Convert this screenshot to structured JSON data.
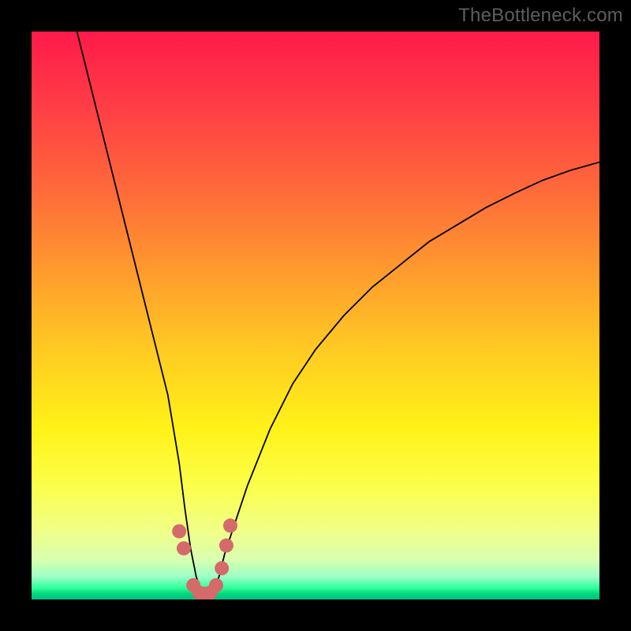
{
  "watermark": "TheBottleneck.com",
  "chart_data": {
    "type": "line",
    "title": "",
    "xlabel": "",
    "ylabel": "",
    "xlim": [
      0,
      100
    ],
    "ylim": [
      0,
      100
    ],
    "grid": false,
    "series": [
      {
        "name": "bottleneck-curve",
        "x": [
          8,
          10,
          12,
          14,
          16,
          18,
          20,
          22,
          24,
          26,
          27,
          28,
          29,
          30,
          31,
          32,
          33,
          34,
          36,
          38,
          42,
          46,
          50,
          55,
          60,
          65,
          70,
          75,
          80,
          85,
          90,
          95,
          100
        ],
        "y": [
          100,
          92,
          84,
          76,
          68,
          60,
          52,
          44,
          36,
          24,
          16,
          9,
          4,
          1,
          0,
          1,
          4,
          8,
          14,
          20,
          30,
          38,
          44,
          50,
          55,
          59,
          63,
          66,
          69,
          71.5,
          73.8,
          75.6,
          77
        ]
      }
    ],
    "markers": {
      "name": "highlight-dots",
      "color": "#d56a6a",
      "x": [
        26.0,
        26.8,
        28.5,
        29.5,
        30.5,
        31.5,
        32.5,
        33.5,
        34.3,
        35.0
      ],
      "y": [
        12.0,
        9.0,
        2.5,
        1.2,
        1.0,
        1.2,
        2.5,
        5.5,
        9.5,
        13.0
      ]
    },
    "background": {
      "type": "vertical-gradient",
      "stops": [
        {
          "pos": 0.0,
          "color": "#ff1a4a"
        },
        {
          "pos": 0.7,
          "color": "#fff218"
        },
        {
          "pos": 0.93,
          "color": "#d9ffb0"
        },
        {
          "pos": 0.98,
          "color": "#2eff9a"
        },
        {
          "pos": 1.0,
          "color": "#00be90"
        }
      ]
    }
  }
}
